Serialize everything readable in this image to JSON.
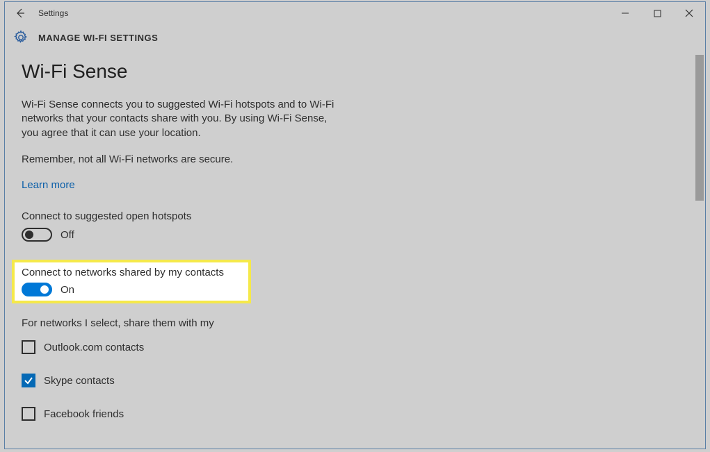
{
  "titlebar": {
    "title": "Settings"
  },
  "header": {
    "heading": "MANAGE WI-FI SETTINGS"
  },
  "page": {
    "title": "Wi-Fi Sense",
    "desc": "Wi-Fi Sense connects you to suggested Wi-Fi hotspots and to Wi-Fi networks that your contacts share with you. By using Wi-Fi Sense, you agree that it can use your location.",
    "remember": "Remember, not all Wi-Fi networks are secure.",
    "learn_more": "Learn more"
  },
  "toggles": {
    "open_hotspots": {
      "label": "Connect to suggested open hotspots",
      "state": "Off"
    },
    "shared_contacts": {
      "label": "Connect to networks shared by my contacts",
      "state": "On"
    }
  },
  "share": {
    "label": "For networks I select, share them with my",
    "items": [
      {
        "label": "Outlook.com contacts",
        "checked": false
      },
      {
        "label": "Skype contacts",
        "checked": true
      },
      {
        "label": "Facebook friends",
        "checked": false
      }
    ]
  }
}
